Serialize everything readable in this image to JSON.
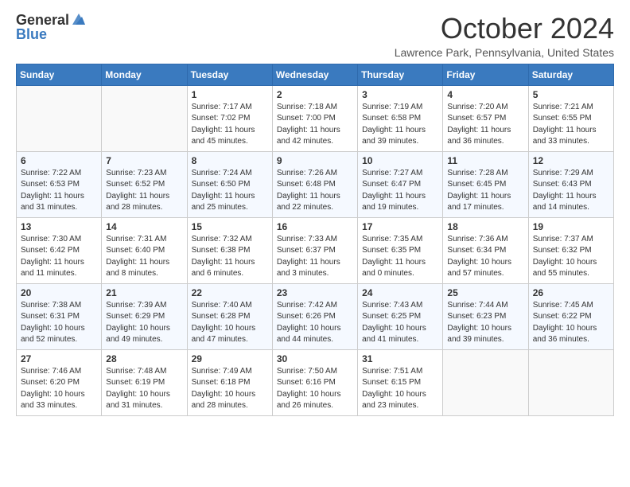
{
  "logo": {
    "general": "General",
    "blue": "Blue"
  },
  "title": "October 2024",
  "location": "Lawrence Park, Pennsylvania, United States",
  "weekdays": [
    "Sunday",
    "Monday",
    "Tuesday",
    "Wednesday",
    "Thursday",
    "Friday",
    "Saturday"
  ],
  "weeks": [
    [
      {
        "day": "",
        "sunrise": "",
        "sunset": "",
        "daylight": ""
      },
      {
        "day": "",
        "sunrise": "",
        "sunset": "",
        "daylight": ""
      },
      {
        "day": "1",
        "sunrise": "Sunrise: 7:17 AM",
        "sunset": "Sunset: 7:02 PM",
        "daylight": "Daylight: 11 hours and 45 minutes."
      },
      {
        "day": "2",
        "sunrise": "Sunrise: 7:18 AM",
        "sunset": "Sunset: 7:00 PM",
        "daylight": "Daylight: 11 hours and 42 minutes."
      },
      {
        "day": "3",
        "sunrise": "Sunrise: 7:19 AM",
        "sunset": "Sunset: 6:58 PM",
        "daylight": "Daylight: 11 hours and 39 minutes."
      },
      {
        "day": "4",
        "sunrise": "Sunrise: 7:20 AM",
        "sunset": "Sunset: 6:57 PM",
        "daylight": "Daylight: 11 hours and 36 minutes."
      },
      {
        "day": "5",
        "sunrise": "Sunrise: 7:21 AM",
        "sunset": "Sunset: 6:55 PM",
        "daylight": "Daylight: 11 hours and 33 minutes."
      }
    ],
    [
      {
        "day": "6",
        "sunrise": "Sunrise: 7:22 AM",
        "sunset": "Sunset: 6:53 PM",
        "daylight": "Daylight: 11 hours and 31 minutes."
      },
      {
        "day": "7",
        "sunrise": "Sunrise: 7:23 AM",
        "sunset": "Sunset: 6:52 PM",
        "daylight": "Daylight: 11 hours and 28 minutes."
      },
      {
        "day": "8",
        "sunrise": "Sunrise: 7:24 AM",
        "sunset": "Sunset: 6:50 PM",
        "daylight": "Daylight: 11 hours and 25 minutes."
      },
      {
        "day": "9",
        "sunrise": "Sunrise: 7:26 AM",
        "sunset": "Sunset: 6:48 PM",
        "daylight": "Daylight: 11 hours and 22 minutes."
      },
      {
        "day": "10",
        "sunrise": "Sunrise: 7:27 AM",
        "sunset": "Sunset: 6:47 PM",
        "daylight": "Daylight: 11 hours and 19 minutes."
      },
      {
        "day": "11",
        "sunrise": "Sunrise: 7:28 AM",
        "sunset": "Sunset: 6:45 PM",
        "daylight": "Daylight: 11 hours and 17 minutes."
      },
      {
        "day": "12",
        "sunrise": "Sunrise: 7:29 AM",
        "sunset": "Sunset: 6:43 PM",
        "daylight": "Daylight: 11 hours and 14 minutes."
      }
    ],
    [
      {
        "day": "13",
        "sunrise": "Sunrise: 7:30 AM",
        "sunset": "Sunset: 6:42 PM",
        "daylight": "Daylight: 11 hours and 11 minutes."
      },
      {
        "day": "14",
        "sunrise": "Sunrise: 7:31 AM",
        "sunset": "Sunset: 6:40 PM",
        "daylight": "Daylight: 11 hours and 8 minutes."
      },
      {
        "day": "15",
        "sunrise": "Sunrise: 7:32 AM",
        "sunset": "Sunset: 6:38 PM",
        "daylight": "Daylight: 11 hours and 6 minutes."
      },
      {
        "day": "16",
        "sunrise": "Sunrise: 7:33 AM",
        "sunset": "Sunset: 6:37 PM",
        "daylight": "Daylight: 11 hours and 3 minutes."
      },
      {
        "day": "17",
        "sunrise": "Sunrise: 7:35 AM",
        "sunset": "Sunset: 6:35 PM",
        "daylight": "Daylight: 11 hours and 0 minutes."
      },
      {
        "day": "18",
        "sunrise": "Sunrise: 7:36 AM",
        "sunset": "Sunset: 6:34 PM",
        "daylight": "Daylight: 10 hours and 57 minutes."
      },
      {
        "day": "19",
        "sunrise": "Sunrise: 7:37 AM",
        "sunset": "Sunset: 6:32 PM",
        "daylight": "Daylight: 10 hours and 55 minutes."
      }
    ],
    [
      {
        "day": "20",
        "sunrise": "Sunrise: 7:38 AM",
        "sunset": "Sunset: 6:31 PM",
        "daylight": "Daylight: 10 hours and 52 minutes."
      },
      {
        "day": "21",
        "sunrise": "Sunrise: 7:39 AM",
        "sunset": "Sunset: 6:29 PM",
        "daylight": "Daylight: 10 hours and 49 minutes."
      },
      {
        "day": "22",
        "sunrise": "Sunrise: 7:40 AM",
        "sunset": "Sunset: 6:28 PM",
        "daylight": "Daylight: 10 hours and 47 minutes."
      },
      {
        "day": "23",
        "sunrise": "Sunrise: 7:42 AM",
        "sunset": "Sunset: 6:26 PM",
        "daylight": "Daylight: 10 hours and 44 minutes."
      },
      {
        "day": "24",
        "sunrise": "Sunrise: 7:43 AM",
        "sunset": "Sunset: 6:25 PM",
        "daylight": "Daylight: 10 hours and 41 minutes."
      },
      {
        "day": "25",
        "sunrise": "Sunrise: 7:44 AM",
        "sunset": "Sunset: 6:23 PM",
        "daylight": "Daylight: 10 hours and 39 minutes."
      },
      {
        "day": "26",
        "sunrise": "Sunrise: 7:45 AM",
        "sunset": "Sunset: 6:22 PM",
        "daylight": "Daylight: 10 hours and 36 minutes."
      }
    ],
    [
      {
        "day": "27",
        "sunrise": "Sunrise: 7:46 AM",
        "sunset": "Sunset: 6:20 PM",
        "daylight": "Daylight: 10 hours and 33 minutes."
      },
      {
        "day": "28",
        "sunrise": "Sunrise: 7:48 AM",
        "sunset": "Sunset: 6:19 PM",
        "daylight": "Daylight: 10 hours and 31 minutes."
      },
      {
        "day": "29",
        "sunrise": "Sunrise: 7:49 AM",
        "sunset": "Sunset: 6:18 PM",
        "daylight": "Daylight: 10 hours and 28 minutes."
      },
      {
        "day": "30",
        "sunrise": "Sunrise: 7:50 AM",
        "sunset": "Sunset: 6:16 PM",
        "daylight": "Daylight: 10 hours and 26 minutes."
      },
      {
        "day": "31",
        "sunrise": "Sunrise: 7:51 AM",
        "sunset": "Sunset: 6:15 PM",
        "daylight": "Daylight: 10 hours and 23 minutes."
      },
      {
        "day": "",
        "sunrise": "",
        "sunset": "",
        "daylight": ""
      },
      {
        "day": "",
        "sunrise": "",
        "sunset": "",
        "daylight": ""
      }
    ]
  ]
}
